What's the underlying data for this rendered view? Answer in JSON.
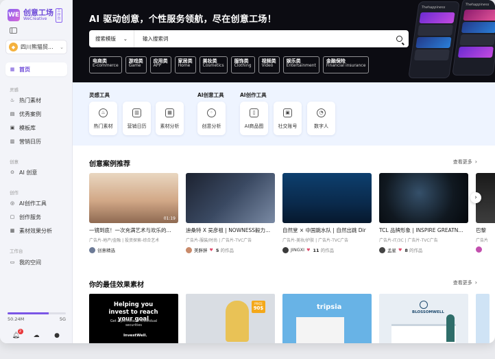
{
  "brand": {
    "cn": "创意工场",
    "en": "WeCreative",
    "tag": "工作台",
    "logo": "WE"
  },
  "org": {
    "name": "四川熊猫贸..."
  },
  "nav": {
    "home": "首页",
    "sections": [
      {
        "label": "灵感",
        "items": [
          "热门素材",
          "优秀案例",
          "模板库",
          "营销日历"
        ]
      },
      {
        "label": "创意",
        "items": [
          "AI 创意"
        ]
      },
      {
        "label": "创作",
        "items": [
          "AI创作工具",
          "创作服务",
          "素材效果分析"
        ]
      },
      {
        "label": "工作台",
        "items": [
          "我的空间"
        ]
      }
    ],
    "storage": {
      "used": "50.24M",
      "total": "5G",
      "fraction": 0.01
    },
    "notification_count": "2"
  },
  "hero": {
    "title": "AI 驱动创意，个性服务领航，尽在创意工场！",
    "search_type": "搜索模版",
    "search_placeholder": "输入搜索词",
    "categories": [
      {
        "cn": "电商类",
        "en": "E-commerce"
      },
      {
        "cn": "游戏类",
        "en": "Game"
      },
      {
        "cn": "应用类",
        "en": "APP"
      },
      {
        "cn": "家居类",
        "en": "Home"
      },
      {
        "cn": "美妆类",
        "en": "Cosmetics"
      },
      {
        "cn": "服饰类",
        "en": "Clothing"
      },
      {
        "cn": "视频类",
        "en": "Video"
      },
      {
        "cn": "娱乐类",
        "en": "Entertainment"
      },
      {
        "cn": "金融保险",
        "en": "Financial insurance"
      }
    ],
    "phone_title": "Thehappiness"
  },
  "tools": {
    "inspiration_title": "灵感工具",
    "inspiration": [
      "热门素材",
      "营销日历",
      "素材分析"
    ],
    "ai_creative_title": "AI创意工具",
    "ai_creative": [
      "创意分析"
    ],
    "ai_creation_title": "AI创作工具",
    "ai_creation": [
      "AI商品图",
      "社交账号",
      "数字人"
    ]
  },
  "cases": {
    "title": "创意案例推荐",
    "see_more": "查看更多",
    "items": [
      {
        "title": "一镜到底！一次充满艺术与欢乐的...",
        "tags": "广告片-地产/金融 | 投资探索-综合艺术",
        "author": "创意精选",
        "duration": "01:19",
        "count": ""
      },
      {
        "title": "迪桑特 X 吴彦祖 | NOWNESS毅力...",
        "tags": "广告片-服装/时尚 | 广告片-TVC广告",
        "author": "美胖胖",
        "duration": "",
        "count": "5"
      },
      {
        "title": "自然堂 × 中国跳水队 | 自然出跳 Dir",
        "tags": "广告片-美妆/护肤 | 广告片-TVC广告",
        "author": "JINGXI",
        "duration": "",
        "count": "11"
      },
      {
        "title": "TCL 品牌形象 | INSPIRE GREATN...",
        "tags": "广告片-IT/3C | 广告片-TVC广告",
        "author": "孟星",
        "duration": "",
        "count": "8"
      },
      {
        "title": "巴黎",
        "tags": "广告片",
        "author": "",
        "duration": "",
        "count": ""
      }
    ],
    "works_label": "的作品"
  },
  "effects": {
    "title": "你的最佳效果素材",
    "see_more": "查看更多",
    "ads": [
      {
        "headline": "Helping you invest to reach your goal",
        "sub": "Get a portfolio of individual securities",
        "brand": "InvestWell."
      },
      {
        "price_label": "PRICE",
        "price": "90$"
      },
      {
        "brand": "tripsia"
      },
      {
        "brand": "BLOSSOMWELL"
      }
    ]
  },
  "colors": {
    "accent": "#6c48d8",
    "hero_bg": "#0c0c12",
    "tools_bg": "#eef4ff"
  }
}
